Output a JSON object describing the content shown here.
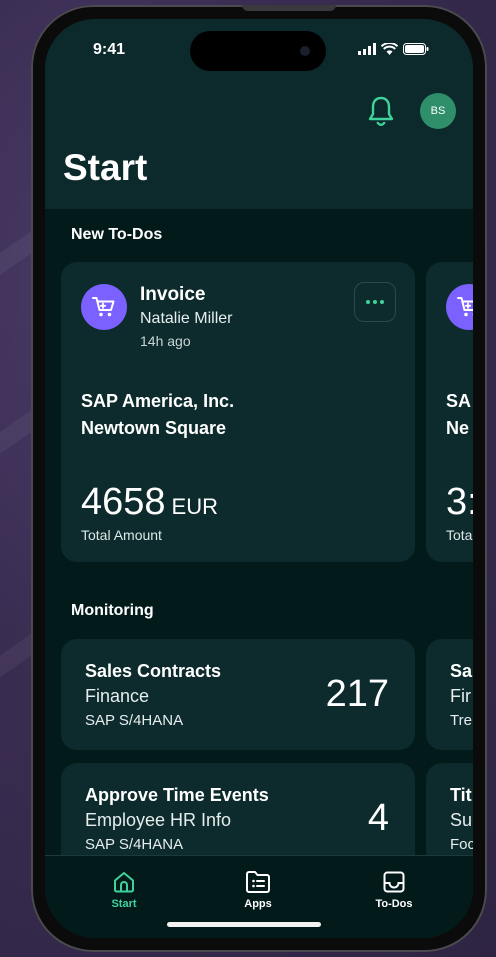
{
  "status_bar": {
    "time": "9:41"
  },
  "header": {
    "avatar_initials": "BS",
    "title": "Start"
  },
  "todos": {
    "section_title": "New To-Dos",
    "cards": [
      {
        "icon": "cart-icon",
        "title": "Invoice",
        "person": "Natalie Miller",
        "time": "14h ago",
        "company_line1": "SAP America, Inc.",
        "company_line2": "Newtown Square",
        "amount": "4658",
        "currency": "EUR",
        "amount_label": "Total Amount"
      },
      {
        "icon": "cart-icon",
        "title": "",
        "company_line1": "SA",
        "company_line2": "Ne",
        "amount": "3:",
        "amount_label": "Tota"
      }
    ]
  },
  "monitoring": {
    "section_title": "Monitoring",
    "cards": [
      {
        "title": "Sales Contracts",
        "subtitle": "Finance",
        "system": "SAP S/4HANA",
        "count": "217"
      },
      {
        "title": "Sa",
        "subtitle": "Fir",
        "system": "Tre"
      },
      {
        "title": "Approve Time Events",
        "subtitle": "Employee HR Info",
        "system": "SAP S/4HANA",
        "count": "4"
      },
      {
        "title": "Tit",
        "subtitle": "Su",
        "system": "Foc"
      }
    ]
  },
  "tabbar": {
    "tabs": [
      {
        "label": "Start",
        "icon": "home-icon",
        "active": true
      },
      {
        "label": "Apps",
        "icon": "apps-icon",
        "active": false
      },
      {
        "label": "To-Dos",
        "icon": "inbox-icon",
        "active": false
      }
    ]
  },
  "colors": {
    "accent": "#3dd39a",
    "avatar": "#2e8f6a",
    "cart_circle": "#7b61ff",
    "card": "#0d2b2c",
    "background": "#031a1b"
  }
}
